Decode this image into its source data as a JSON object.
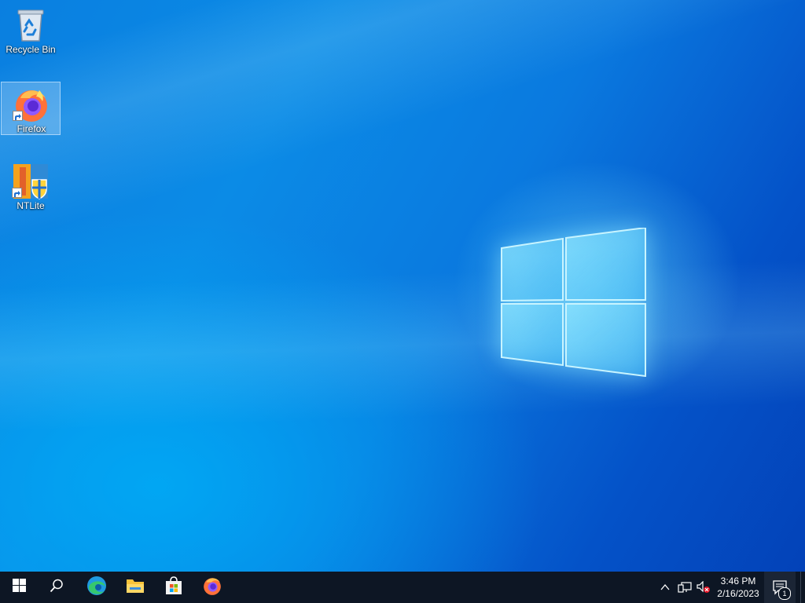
{
  "desktop": {
    "icons": [
      {
        "label": "Recycle Bin",
        "icon": "recycle-bin-icon"
      },
      {
        "label": "Firefox",
        "icon": "firefox-icon"
      },
      {
        "label": "NTLite",
        "icon": "ntlite-icon"
      }
    ]
  },
  "taskbar": {
    "start": "windows-start-icon",
    "search": "search-icon",
    "pinned": [
      "edge-icon",
      "file-explorer-icon",
      "microsoft-store-icon",
      "firefox-icon"
    ],
    "tray": {
      "overflow": "chevron-up-icon",
      "network": "network-icon",
      "volume": "volume-muted-icon",
      "time": "3:46 PM",
      "date": "2/16/2023",
      "notification_count": "1"
    }
  },
  "colors": {
    "taskbar": "#0d1624",
    "desktop_accent": "#0a7fe0"
  }
}
